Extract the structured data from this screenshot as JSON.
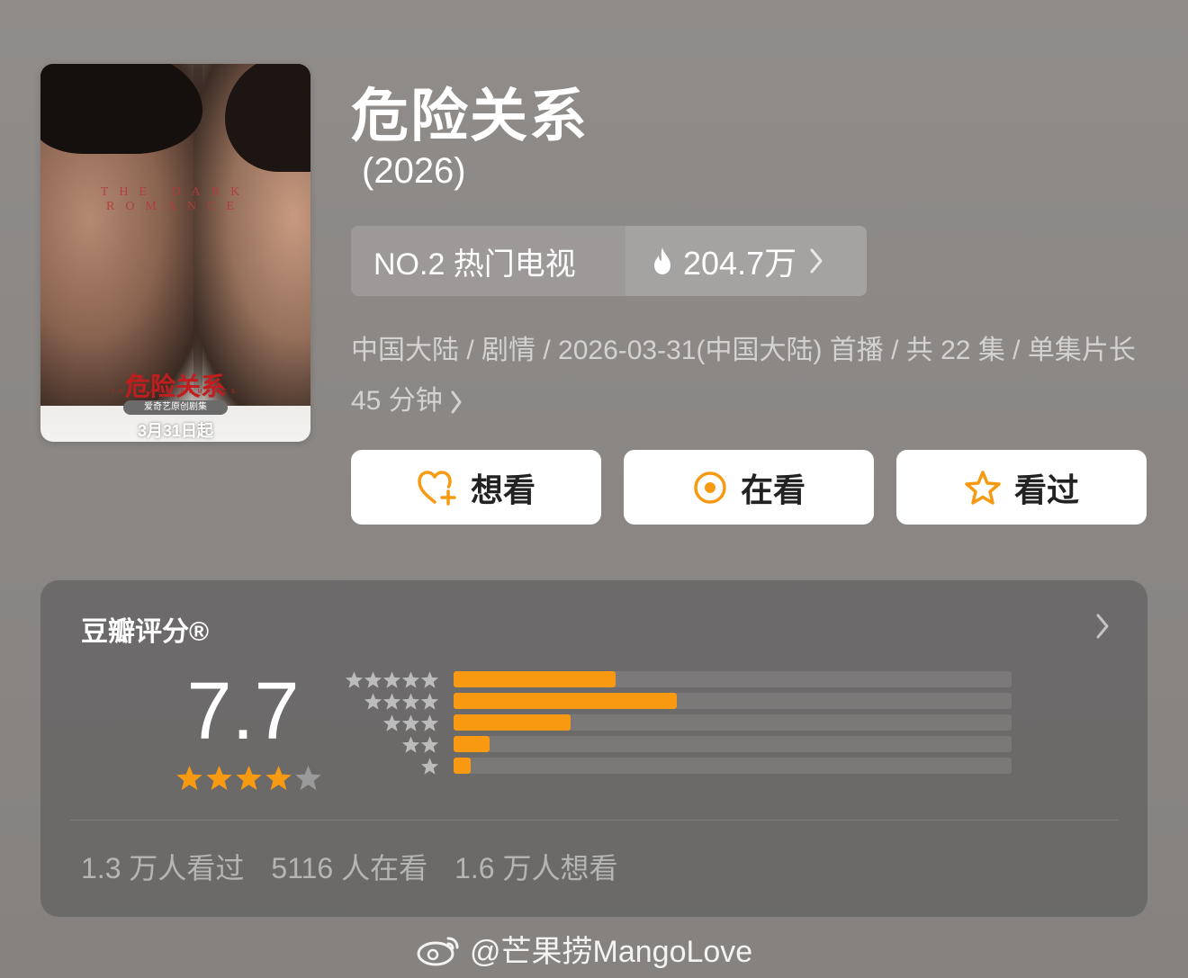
{
  "poster": {
    "overlay_title": "THE DARK ROMANCE",
    "cn_title": "危险关系",
    "en_sub": "THE DARK ROMANCE",
    "badge": "爱奇艺原创剧集",
    "date": "3月31日起"
  },
  "title": "危险关系",
  "year": "(2026)",
  "rank": {
    "label": "NO.2 热门电视",
    "heat": "204.7万",
    "heat_icon": "flame-icon"
  },
  "meta": {
    "text": "中国大陆 / 剧情 / 2026-03-31(中国大陆) 首播 / 共 22 集 / 单集片长 45 分钟"
  },
  "actions": {
    "want": "想看",
    "watching": "在看",
    "watched": "看过"
  },
  "rating": {
    "title": "豆瓣评分®",
    "score": "7.7",
    "stars_filled": 4,
    "stars_total": 5,
    "distribution": [
      {
        "stars": 5,
        "fraction": 0.29
      },
      {
        "stars": 4,
        "fraction": 0.4
      },
      {
        "stars": 3,
        "fraction": 0.21
      },
      {
        "stars": 2,
        "fraction": 0.065
      },
      {
        "stars": 1,
        "fraction": 0.03
      }
    ],
    "counts": {
      "watched": "1.3 万人看过",
      "watching": "5116 人在看",
      "want": "1.6 万人想看"
    }
  },
  "colors": {
    "accent": "#f79a12",
    "star_grey": "#9a9a9a"
  },
  "watermark": "@芒果捞MangoLove"
}
